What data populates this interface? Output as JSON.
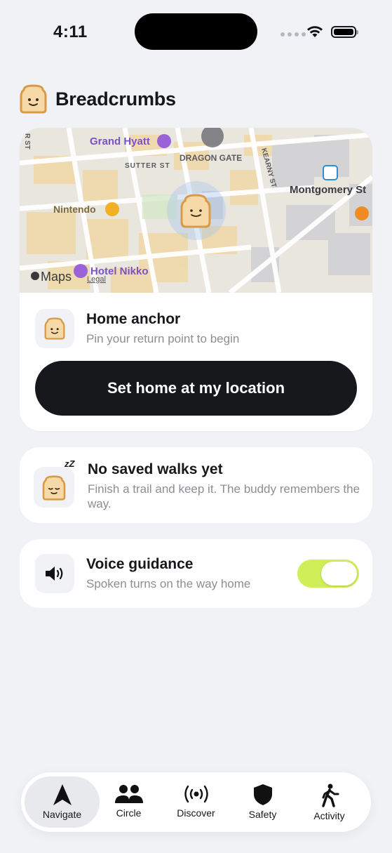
{
  "status_bar": {
    "time": "4:11"
  },
  "app": {
    "title": "Breadcrumbs"
  },
  "map": {
    "pois": [
      "Grand Hyatt",
      "DRAGON GATE",
      "Montgomery St",
      "Nintendo",
      "Hotel Nikko"
    ],
    "streets": [
      "SUTTER ST",
      "KEARNY ST",
      "R ST"
    ],
    "attribution": "Maps",
    "legal": "Legal"
  },
  "home": {
    "title": "Home anchor",
    "subtitle": "Pin your return point to begin",
    "cta": "Set home at my location"
  },
  "walks": {
    "title": "No saved walks yet",
    "subtitle": "Finish a trail and keep it. The buddy remembers the way.",
    "sleep_glyph": "zZ"
  },
  "voice": {
    "title": "Voice guidance",
    "subtitle": "Spoken turns on the way home",
    "enabled": true
  },
  "tabs": [
    {
      "label": "Navigate",
      "icon": "navigation-arrow-icon",
      "active": true
    },
    {
      "label": "Circle",
      "icon": "people-icon",
      "active": false
    },
    {
      "label": "Discover",
      "icon": "broadcast-icon",
      "active": false
    },
    {
      "label": "Safety",
      "icon": "shield-icon",
      "active": false
    },
    {
      "label": "Activity",
      "icon": "walking-icon",
      "active": false
    }
  ],
  "colors": {
    "background": "#f1f2f6",
    "card": "#ffffff",
    "cta": "#16181b",
    "toggle_on": "#cfee57",
    "buddy": "#f6d9a6",
    "buddy_outline": "#d99a48"
  }
}
